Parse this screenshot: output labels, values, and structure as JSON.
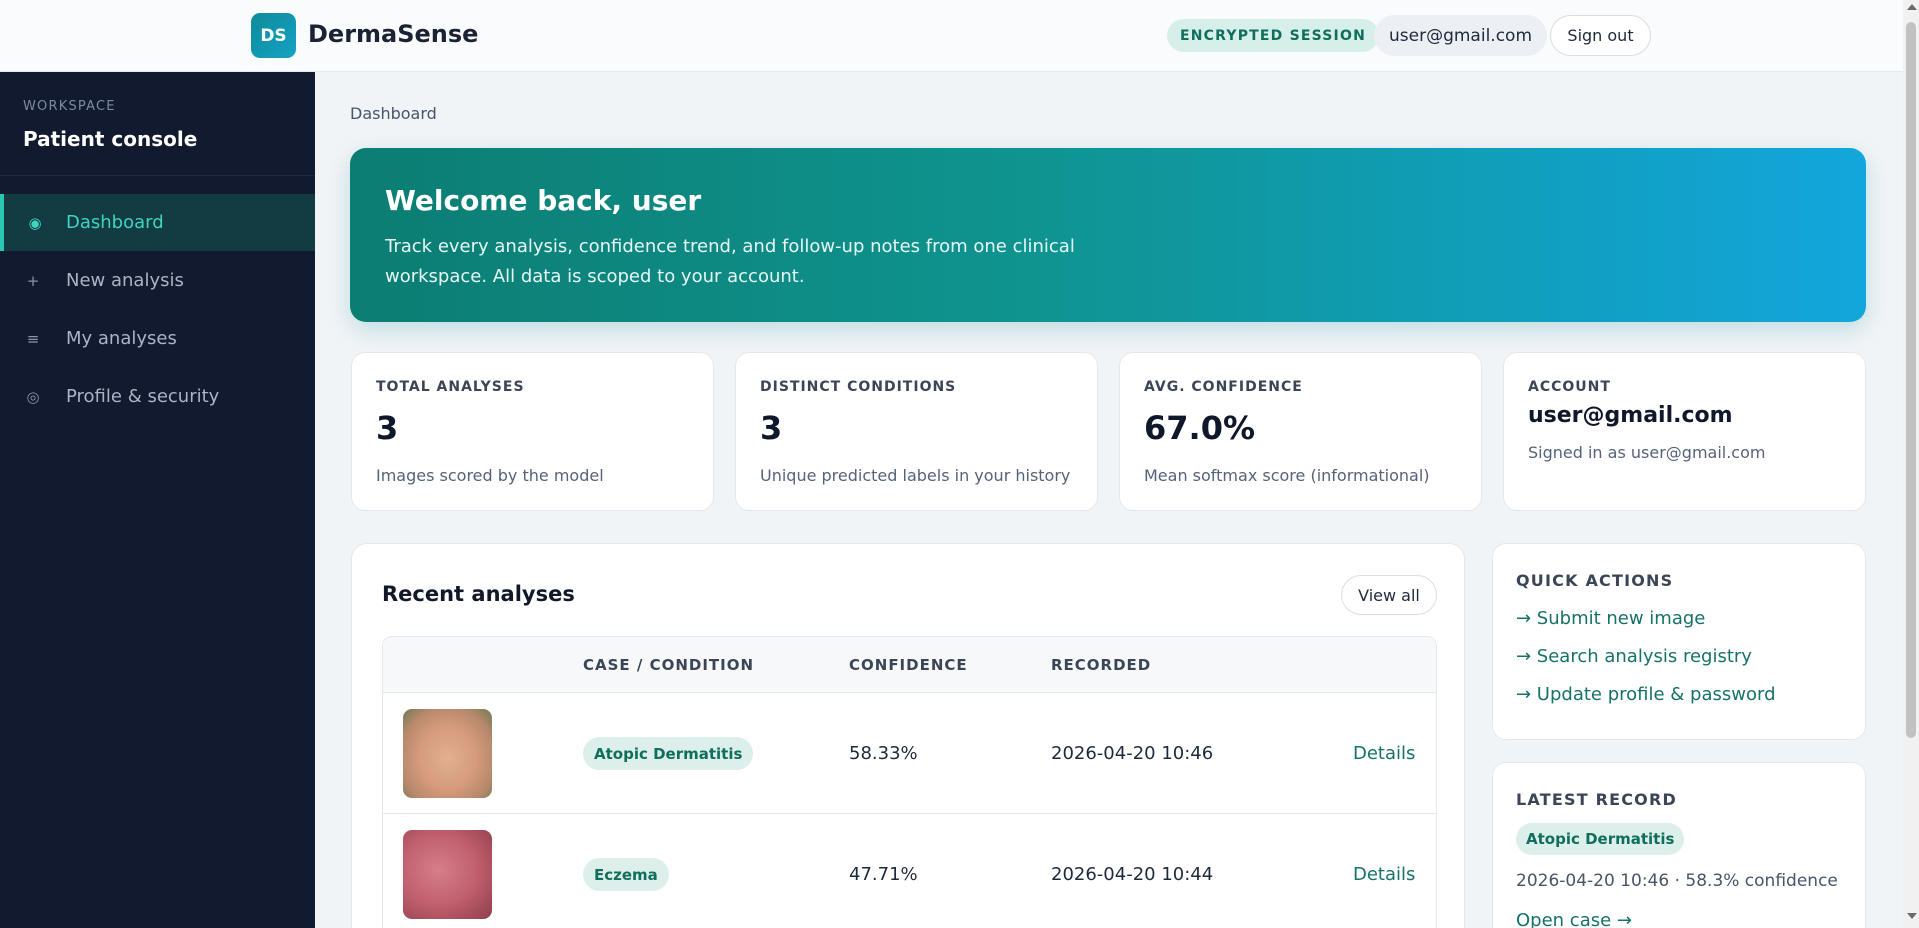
{
  "header": {
    "logo_initials": "DS",
    "brand": "DermaSense",
    "session_badge": "ENCRYPTED SESSION",
    "user_email": "user@gmail.com",
    "signout_label": "Sign out"
  },
  "sidebar": {
    "workspace_label": "WORKSPACE",
    "workspace_title": "Patient console",
    "items": [
      {
        "icon": "◉",
        "label": "Dashboard",
        "active": true
      },
      {
        "icon": "+",
        "label": "New analysis",
        "active": false
      },
      {
        "icon": "≡",
        "label": "My analyses",
        "active": false
      },
      {
        "icon": "◎",
        "label": "Profile & security",
        "active": false
      }
    ]
  },
  "main": {
    "breadcrumb": "Dashboard",
    "hero": {
      "title": "Welcome back, user",
      "text": "Track every analysis, confidence trend, and follow-up notes from one clinical workspace. All data is scoped to your account."
    },
    "stats": [
      {
        "label": "TOTAL ANALYSES",
        "value": "3",
        "sub": "Images scored by the model"
      },
      {
        "label": "DISTINCT CONDITIONS",
        "value": "3",
        "sub": "Unique predicted labels in your history"
      },
      {
        "label": "AVG. CONFIDENCE",
        "value": "67.0%",
        "sub": "Mean softmax score (informational)"
      },
      {
        "label": "ACCOUNT",
        "value": "user@gmail.com",
        "sub": "Signed in as user@gmail.com"
      }
    ],
    "recent": {
      "title": "Recent analyses",
      "view_all": "View all",
      "columns": [
        "",
        "CASE / CONDITION",
        "CONFIDENCE",
        "RECORDED",
        ""
      ],
      "rows": [
        {
          "condition": "Atopic Dermatitis",
          "confidence": "58.33%",
          "recorded": "2026-04-20 10:46",
          "action": "Details"
        },
        {
          "condition": "Eczema",
          "confidence": "47.71%",
          "recorded": "2026-04-20 10:44",
          "action": "Details"
        }
      ]
    },
    "quick_actions": {
      "title": "QUICK ACTIONS",
      "links": [
        "→ Submit new image",
        "→ Search analysis registry",
        "→ Update profile & password"
      ]
    },
    "latest_record": {
      "title": "LATEST RECORD",
      "condition": "Atopic Dermatitis",
      "meta": "2026-04-20 10:46 · 58.3% confidence",
      "open": "Open case →"
    }
  },
  "colors": {
    "accent": "#167268",
    "sidebar_bg": "#111a2e",
    "active_nav": "#3ed4c0",
    "hero_start": "#0c7d72",
    "hero_end": "#12a6dc"
  }
}
